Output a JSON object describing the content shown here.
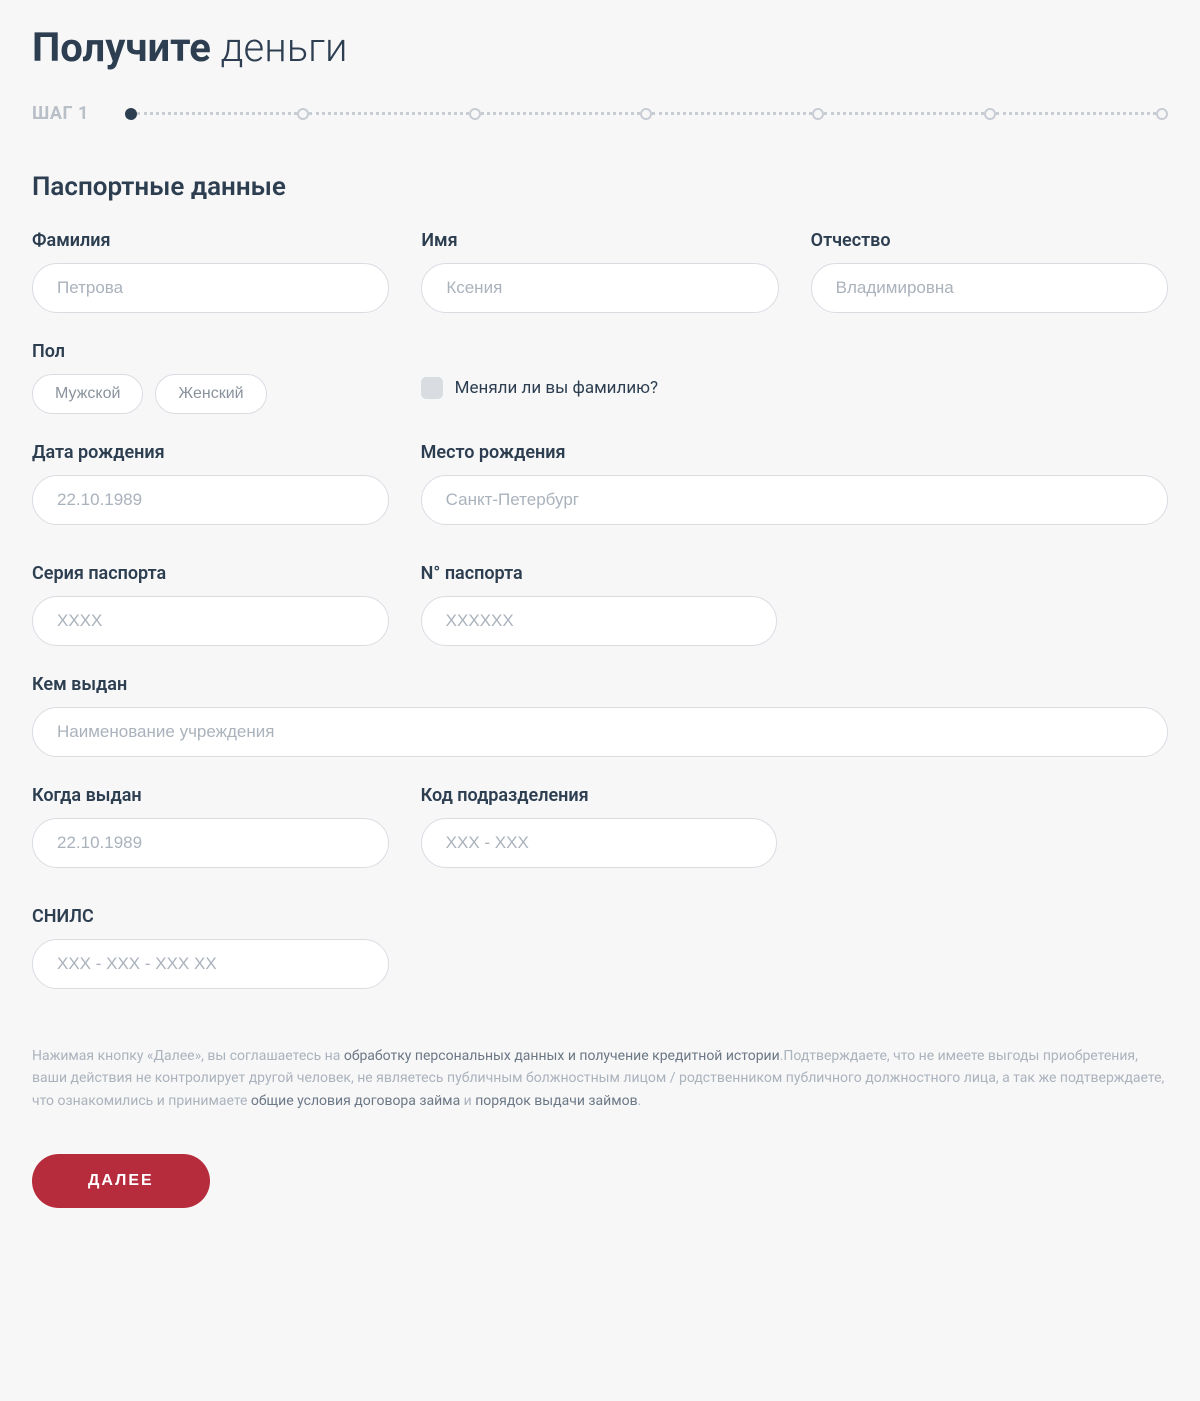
{
  "title": {
    "bold": "Получите",
    "light": " деньги"
  },
  "step": {
    "label": "ШАГ 1",
    "current": 1,
    "total": 7
  },
  "section_header": "Паспортные данные",
  "fields": {
    "last_name": {
      "label": "Фамилия",
      "placeholder": "Петрова"
    },
    "first_name": {
      "label": "Имя",
      "placeholder": "Ксения"
    },
    "patronymic": {
      "label": "Отчество",
      "placeholder": "Владимировна"
    },
    "gender": {
      "label": "Пол",
      "options": {
        "male": "Мужской",
        "female": "Женский"
      }
    },
    "name_changed": {
      "label": "Меняли ли вы фамилию?"
    },
    "birth_date": {
      "label": "Дата рождения",
      "placeholder": "22.10.1989"
    },
    "birth_place": {
      "label": "Место рождения",
      "placeholder": "Санкт-Петербург"
    },
    "passport_series": {
      "label": "Серия паспорта",
      "placeholder": "XXXX"
    },
    "passport_number": {
      "label": "N° паспорта",
      "placeholder": "XXXXXX"
    },
    "issued_by": {
      "label": "Кем выдан",
      "placeholder": "Наименование учреждения"
    },
    "issue_date": {
      "label": "Когда выдан",
      "placeholder": "22.10.1989"
    },
    "division_code": {
      "label": "Код подразделения",
      "placeholder": "XXX - XXX"
    },
    "snils": {
      "label": "СНИЛС",
      "placeholder": "XXX - XXX - XXX XX"
    }
  },
  "legal": {
    "p1": "Нажимая кнопку «Далее», вы соглашаетесь на ",
    "link1": "обработку персональных данных и получение кредитной истории",
    "p2": ".Подтверждаете, что не имеете выгоды приобретения, ваши действия не контролирует другой человек, не являетесь публичным болжностным лицом / родственником публичного должностного лица, а так же подтверждаете, что ознакомились и принимаете ",
    "link2": "общие условия договора займа",
    "and": " и ",
    "link3": "порядок выдачи займов",
    "dot": "."
  },
  "button": {
    "next": "ДАЛЕЕ"
  }
}
